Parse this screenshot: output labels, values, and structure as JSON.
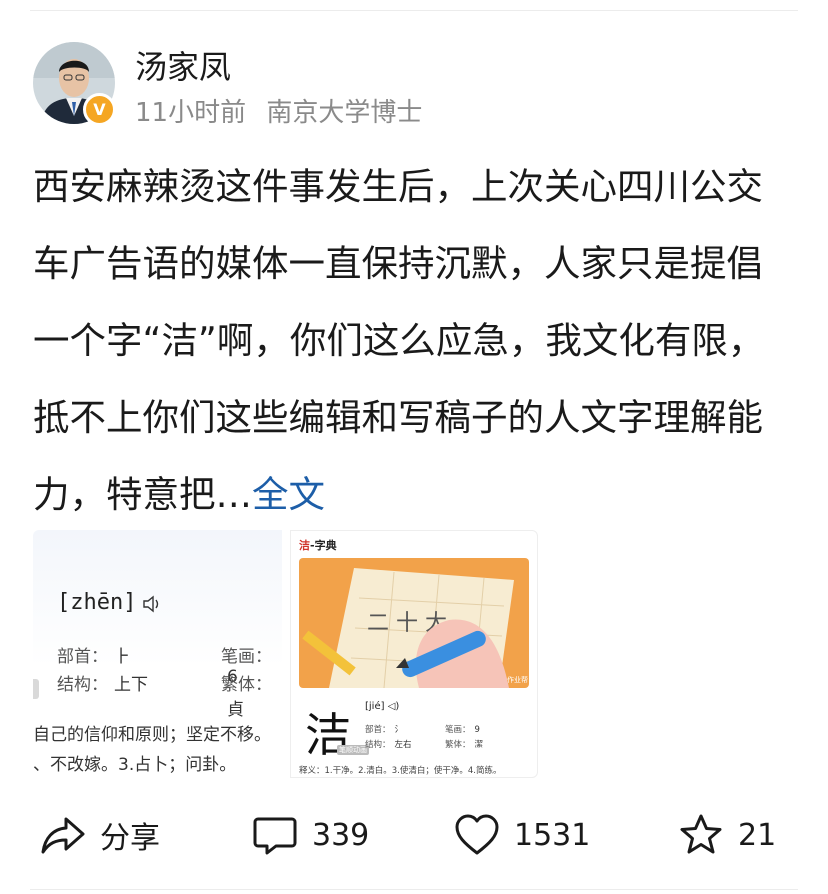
{
  "author": {
    "name": "汤家凤",
    "badge": "V",
    "time": "11小时前",
    "title": "南京大学博士"
  },
  "post": {
    "text": "西安麻辣烫这件事发生后，上次关心四川公交车广告语的媒体一直保持沉默，人家只是提倡一个字“洁”啊，你们这么应急，我文化有限，抵不上你们这些编辑和写稿子的人文字理解能力，特意把…",
    "more_label": "全文"
  },
  "images": [
    {
      "pinyin": "[zhēn]",
      "radical_label": "部首：",
      "radical": "⺊",
      "strokes_label": "笔画：",
      "strokes": "6",
      "structure_label": "结构：",
      "structure": "上下",
      "traditional_label": "繁体：",
      "traditional": "貞",
      "line1": "自己的信仰和原则；坚定不移。",
      "line2": "、不改嫁。3.占卜；问卦。"
    },
    {
      "title_char": "洁",
      "title_suffix": "-字典",
      "illus_chars": "二 十 大",
      "watermark": "作业帮",
      "char": "洁",
      "char_badge": "笔顺动画",
      "pinyin": "[jié]",
      "radical_label": "部首：",
      "radical": "氵",
      "strokes_label": "笔画：",
      "strokes": "9",
      "structure_label": "结构：",
      "structure": "左右",
      "traditional_label": "繁体：",
      "traditional": "潔",
      "definition": "释义：1.干净。2.清白。3.使清白；使干净。4.简练。"
    }
  ],
  "actions": {
    "share_label": "分享",
    "comments": "339",
    "likes": "1531",
    "favorites": "21"
  },
  "colors": {
    "link": "#1d5ea8",
    "meta": "#8a8a8a",
    "verified": "#f5a623",
    "dict_red": "#d0342c"
  }
}
